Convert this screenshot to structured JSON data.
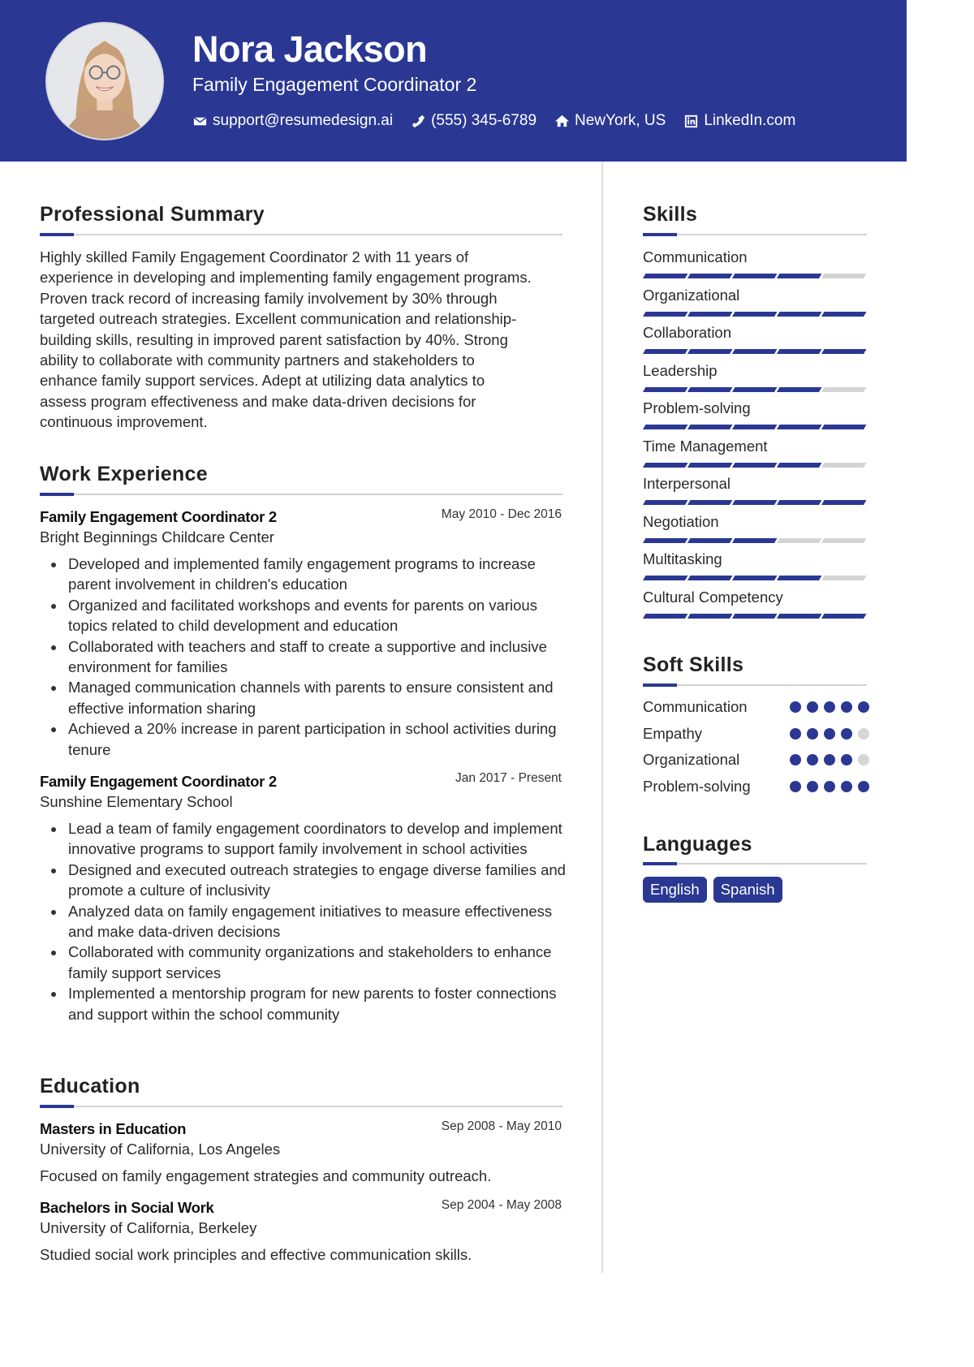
{
  "header": {
    "name": "Nora Jackson",
    "role": "Family Engagement Coordinator 2",
    "contacts": [
      {
        "icon": "envelope-icon",
        "text": "support@resumedesign.ai"
      },
      {
        "icon": "phone-icon",
        "text": "(555) 345-6789"
      },
      {
        "icon": "home-icon",
        "text": "NewYork, US"
      },
      {
        "icon": "linkedin-icon",
        "text": "LinkedIn.com"
      }
    ]
  },
  "summary": {
    "title": "Professional Summary",
    "lines": [
      "Highly skilled Family Engagement Coordinator 2 with 11 years of",
      "experience in developing and implementing family engagement programs.",
      "Proven track record of increasing family involvement by 30% through",
      "targeted outreach strategies. Excellent communication and relationship-",
      "building skills, resulting in improved parent satisfaction by 40%. Strong",
      "ability to collaborate with community partners and stakeholders to",
      "enhance family support services. Adept at utilizing data analytics to",
      "assess program effectiveness and make data-driven decisions for",
      "continuous improvement."
    ]
  },
  "experience": {
    "title": "Work Experience",
    "jobs": [
      {
        "title": "Family Engagement Coordinator 2",
        "org": "Bright Beginnings Childcare Center",
        "dates": "May 2010 - Dec 2016",
        "bullets": [
          "Developed and implemented family engagement programs to increase parent involvement in children's education",
          "Organized and facilitated workshops and events for parents on various topics related to child development and education",
          "Collaborated with teachers and staff to create a supportive and inclusive environment for families",
          "Managed communication channels with parents to ensure consistent and effective information sharing",
          "Achieved a 20% increase in parent participation in school activities during tenure"
        ]
      },
      {
        "title": "Family Engagement Coordinator 2",
        "org": "Sunshine Elementary School",
        "dates": "Jan 2017 - Present",
        "bullets": [
          "Lead a team of family engagement coordinators to develop and implement innovative programs to support family involvement in school activities",
          "Designed and executed outreach strategies to engage diverse families and promote a culture of inclusivity",
          "Analyzed data on family engagement initiatives to measure effectiveness and make data-driven decisions",
          "Collaborated with community organizations and stakeholders to enhance family support services",
          "Implemented a mentorship program for new parents to foster connections and support within the school community"
        ]
      }
    ]
  },
  "education": {
    "title": "Education",
    "items": [
      {
        "degree": "Masters in Education",
        "school": "University of California, Los Angeles",
        "dates": "Sep 2008 - May 2010",
        "desc": "Focused on family engagement strategies and community outreach."
      },
      {
        "degree": "Bachelors in Social Work",
        "school": "University of California, Berkeley",
        "dates": "Sep 2004 - May 2008",
        "desc": "Studied social work principles and effective communication skills."
      }
    ]
  },
  "skills": {
    "title": "Skills",
    "max": 5,
    "items": [
      {
        "name": "Communication",
        "level": 4
      },
      {
        "name": "Organizational",
        "level": 5
      },
      {
        "name": "Collaboration",
        "level": 5
      },
      {
        "name": "Leadership",
        "level": 4
      },
      {
        "name": "Problem-solving",
        "level": 5
      },
      {
        "name": "Time Management",
        "level": 4
      },
      {
        "name": "Interpersonal",
        "level": 5
      },
      {
        "name": "Negotiation",
        "level": 3
      },
      {
        "name": "Multitasking",
        "level": 4
      },
      {
        "name": "Cultural Competency",
        "level": 5
      }
    ]
  },
  "soft_skills": {
    "title": "Soft Skills",
    "max": 5,
    "items": [
      {
        "name": "Communication",
        "level": 5
      },
      {
        "name": "Empathy",
        "level": 4
      },
      {
        "name": "Organizational",
        "level": 4
      },
      {
        "name": "Problem-solving",
        "level": 5
      }
    ]
  },
  "languages": {
    "title": "Languages",
    "items": [
      "English",
      "Spanish"
    ]
  },
  "colors": {
    "accent": "#2a3893",
    "inactive": "#d4d4d4"
  }
}
